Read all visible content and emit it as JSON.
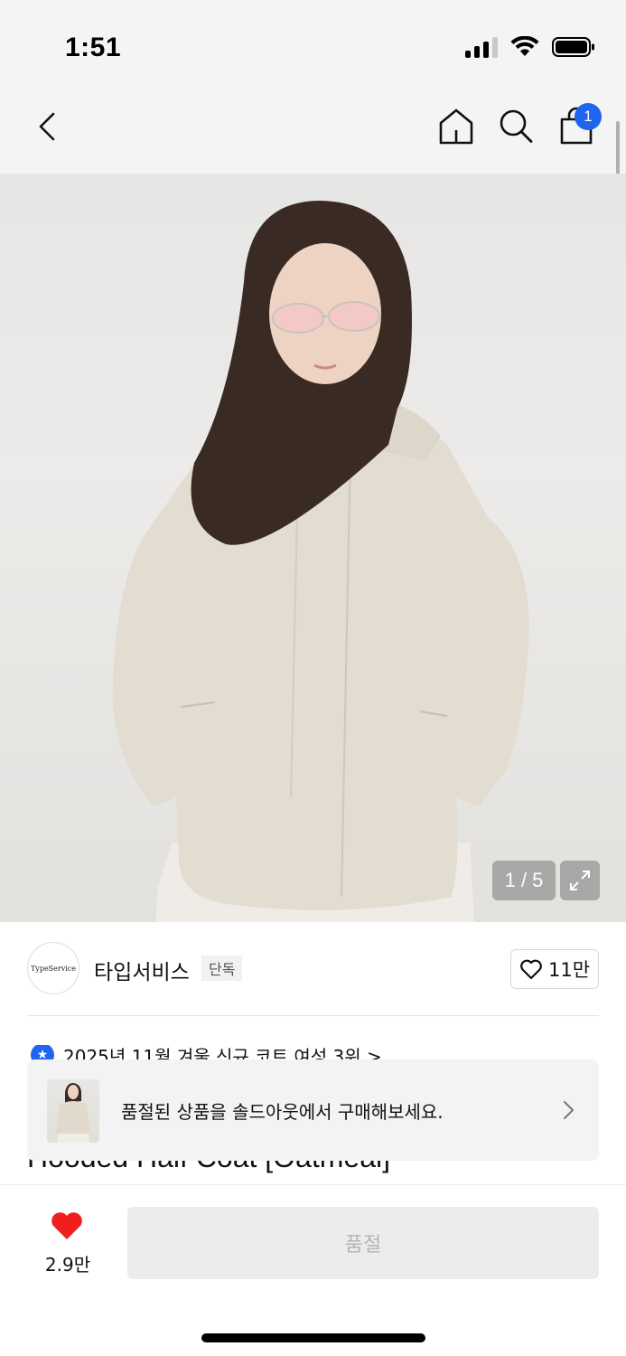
{
  "status_bar": {
    "time": "1:51",
    "icons": [
      "cellular-signal-icon",
      "wifi-icon",
      "battery-icon"
    ]
  },
  "nav": {
    "icons": [
      "back-chevron-icon",
      "home-icon",
      "search-icon",
      "shopping-bag-icon"
    ],
    "cart_count": "1"
  },
  "gallery": {
    "counter": "1 / 5",
    "image_alt": "model-wearing-oatmeal-hooded-coat",
    "expand_icon": "expand-icon"
  },
  "brand": {
    "logo_text": "TypeService",
    "name": "타입서비스",
    "tag": "단독",
    "like_count": "11만"
  },
  "ranking": {
    "text": "2025년 11월 겨울 신규 코트 여성 3위 >"
  },
  "product": {
    "title": "Hooded Half Coat [Oatmeal]"
  },
  "toast": {
    "text": "품절된 상품을 솔드아웃에서 구매해보세요."
  },
  "bottom_bar": {
    "wishlist_count": "2.9만",
    "action_label": "품절"
  },
  "colors": {
    "accent_blue": "#1f65f0",
    "heart_red": "#f01f1f",
    "disabled_button": "#ececec",
    "disabled_text": "#b5b5b5"
  }
}
